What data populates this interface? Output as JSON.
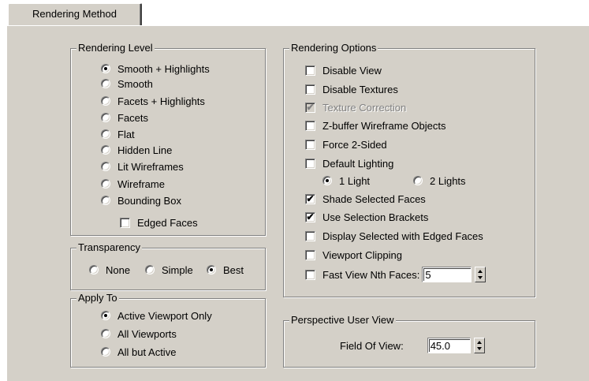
{
  "tab": {
    "label": "Rendering Method"
  },
  "rendering_level": {
    "title": "Rendering Level",
    "options": [
      {
        "label": "Smooth + Highlights",
        "selected": true
      },
      {
        "label": "Smooth",
        "selected": false
      },
      {
        "label": "Facets + Highlights",
        "selected": false
      },
      {
        "label": "Facets",
        "selected": false
      },
      {
        "label": "Flat",
        "selected": false
      },
      {
        "label": "Hidden Line",
        "selected": false
      },
      {
        "label": "Lit Wireframes",
        "selected": false
      },
      {
        "label": "Wireframe",
        "selected": false
      },
      {
        "label": "Bounding Box",
        "selected": false
      }
    ],
    "edged_faces": {
      "label": "Edged Faces",
      "checked": false
    }
  },
  "transparency": {
    "title": "Transparency",
    "options": [
      {
        "label": "None",
        "selected": false
      },
      {
        "label": "Simple",
        "selected": false
      },
      {
        "label": "Best",
        "selected": true
      }
    ]
  },
  "apply_to": {
    "title": "Apply To",
    "options": [
      {
        "label": "Active Viewport Only",
        "selected": true
      },
      {
        "label": "All Viewports",
        "selected": false
      },
      {
        "label": "All but Active",
        "selected": false
      }
    ]
  },
  "rendering_options": {
    "title": "Rendering Options",
    "items": [
      {
        "label": "Disable View",
        "checked": false,
        "disabled": false
      },
      {
        "label": "Disable Textures",
        "checked": false,
        "disabled": false
      },
      {
        "label": "Texture Correction",
        "checked": true,
        "disabled": true
      },
      {
        "label": "Z-buffer Wireframe Objects",
        "checked": false,
        "disabled": false
      },
      {
        "label": "Force 2-Sided",
        "checked": false,
        "disabled": false
      },
      {
        "label": "Default Lighting",
        "checked": false,
        "disabled": false
      }
    ],
    "lights": [
      {
        "label": "1 Light",
        "selected": true
      },
      {
        "label": "2 Lights",
        "selected": false
      }
    ],
    "items2": [
      {
        "label": "Shade Selected Faces",
        "checked": true
      },
      {
        "label": "Use Selection Brackets",
        "checked": true
      },
      {
        "label": "Display Selected with Edged Faces",
        "checked": false
      },
      {
        "label": "Viewport Clipping",
        "checked": false
      }
    ],
    "fast_view": {
      "label": "Fast View Nth Faces:",
      "checked": false,
      "value": "5"
    }
  },
  "perspective": {
    "title": "Perspective User View",
    "fov_label": "Field Of View:",
    "fov_value": "45.0"
  }
}
